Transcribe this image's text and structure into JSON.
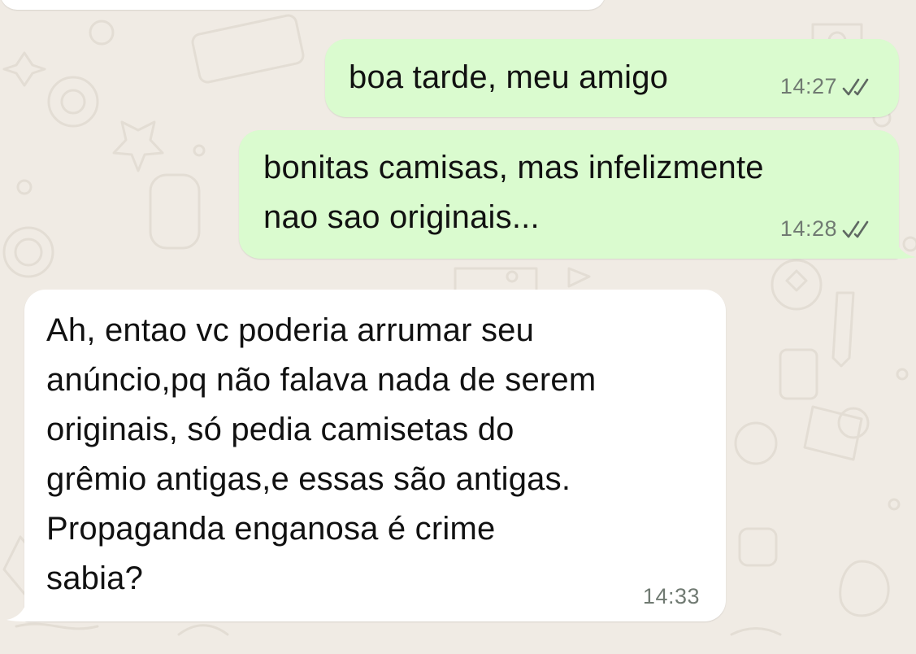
{
  "chat": {
    "messages": [
      {
        "direction": "outgoing",
        "text": "boa tarde, meu amigo",
        "time": "14:27",
        "status": "read-double-check-icon"
      },
      {
        "direction": "outgoing",
        "text": "bonitas camisas, mas infelizmente\nnao sao originais...",
        "time": "14:28",
        "status": "read-double-check-icon"
      },
      {
        "direction": "incoming",
        "text": "Ah, entao vc poderia arrumar seu\nanúncio,pq não falava nada de serem\noriginais, só pedia camisetas do\ngrêmio antigas,e essas são antigas.\nPropaganda enganosa é crime\nsabia?",
        "time": "14:33"
      }
    ]
  },
  "colors": {
    "wallpaper": "#f0ebe4",
    "outgoing_bubble": "#dafbcf",
    "incoming_bubble": "#ffffff",
    "text": "#111111",
    "meta": "#707a72"
  }
}
